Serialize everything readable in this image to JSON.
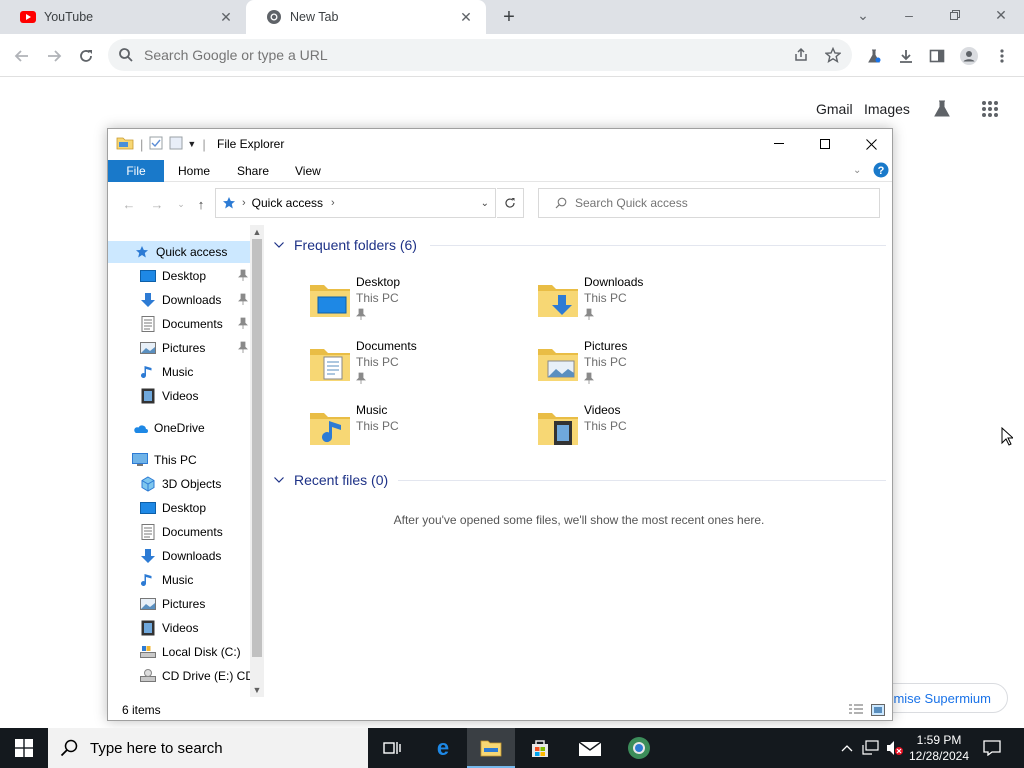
{
  "browser": {
    "tabs": [
      {
        "title": "YouTube"
      },
      {
        "title": "New Tab"
      }
    ],
    "omnibox": {
      "placeholder": "Search Google or type a URL"
    },
    "ntp": {
      "gmail": "Gmail",
      "images": "Images",
      "customise": "mise Supermium"
    }
  },
  "explorer": {
    "title": "File Explorer",
    "ribbon_tabs": [
      "File",
      "Home",
      "Share",
      "View"
    ],
    "address": {
      "segment": "Quick access"
    },
    "search": {
      "placeholder": "Search Quick access"
    },
    "nav": {
      "quick_access": "Quick access",
      "quick_items": [
        "Desktop",
        "Downloads",
        "Documents",
        "Pictures",
        "Music",
        "Videos"
      ],
      "onedrive": "OneDrive",
      "this_pc": "This PC",
      "pc_items": [
        "3D Objects",
        "Desktop",
        "Documents",
        "Downloads",
        "Music",
        "Pictures",
        "Videos",
        "Local Disk (C:)",
        "CD Drive (E:) CDR"
      ]
    },
    "frequent": {
      "header": "Frequent folders (6)",
      "folders": [
        {
          "name": "Desktop",
          "location": "This PC"
        },
        {
          "name": "Downloads",
          "location": "This PC"
        },
        {
          "name": "Documents",
          "location": "This PC"
        },
        {
          "name": "Pictures",
          "location": "This PC"
        },
        {
          "name": "Music",
          "location": "This PC"
        },
        {
          "name": "Videos",
          "location": "This PC"
        }
      ]
    },
    "recent": {
      "header": "Recent files (0)",
      "empty_message": "After you've opened some files, we'll show the most recent ones here."
    },
    "status": {
      "item_count": "6 items"
    }
  },
  "taskbar": {
    "search_placeholder": "Type here to search",
    "time": "1:59 PM",
    "date": "12/28/2024"
  },
  "colors": {
    "file_tab": "#1979ca",
    "selection": "#cce8ff",
    "group_header": "#1e3287",
    "folder_yellow": "#f7d774",
    "taskbar": "#14191e"
  }
}
